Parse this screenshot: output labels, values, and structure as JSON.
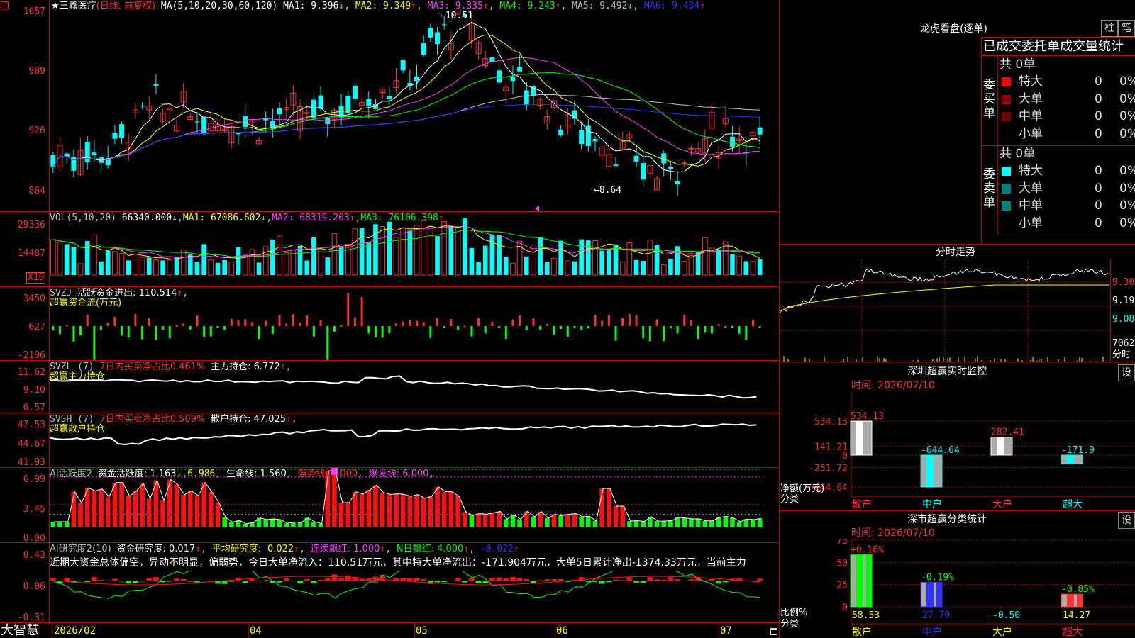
{
  "header": {
    "stock_name": "★三鑫医疗",
    "mode": "(日线, 前复权)",
    "ma_title": "MA(5,10,20,30,60,120)",
    "ma": [
      {
        "label": "MA1: 9.396",
        "arrow": "↓",
        "color": "#ffffff"
      },
      {
        "label": "MA2: 9.349",
        "arrow": "↑",
        "color": "#ffff00"
      },
      {
        "label": "MA3: 9.335",
        "arrow": "↑",
        "color": "#ff40ff"
      },
      {
        "label": "MA4: 9.243",
        "arrow": "↑",
        "color": "#00ff00"
      },
      {
        "label": "MA5: 9.492",
        "arrow": "↓",
        "color": "#c0c0c0"
      },
      {
        "label": "MA6: 9.434",
        "arrow": "↑",
        "color": "#3030ff"
      }
    ],
    "high_mark": "10.51",
    "low_mark": "8.64",
    "corner_icon": "settings-square-icon"
  },
  "price_axis": [
    "1057",
    "989",
    "926",
    "864"
  ],
  "vol": {
    "title": "VOL(5,10,20)",
    "value": "66340.000",
    "value_arrow": "↓",
    "ma1": "MA1: 67086.602",
    "ma1_arrow": "↓",
    "ma2": "MA2: 68319.203",
    "ma2_arrow": "↑",
    "ma3": "MA3: 76106.398",
    "ma3_arrow": "↑",
    "axis": [
      "29336",
      "14487"
    ],
    "unit": "X10"
  },
  "svzj": {
    "title": "SVZJ",
    "line": "活跃资金进出: 110.514",
    "arrow": "↑",
    "trail": ",",
    "subtitle": "超赢资金流(万元)",
    "axis": [
      "3450",
      "627",
      "-2196"
    ]
  },
  "svzl": {
    "title": "SVZL (7)",
    "ratio": "7日内买卖净占比0.461%",
    "hold": "主力持仓: 6.772",
    "arrow": "↑",
    "trail": ",",
    "subtitle": "超赢主力持仓",
    "axis": [
      "11.62",
      "9.10",
      "6.57"
    ]
  },
  "svsh": {
    "title": "SVSH (7)",
    "ratio": "7日内买卖净占比0.509%",
    "hold": "散户持仓: 47.025",
    "arrow": "↑",
    "trail": ",",
    "subtitle": "超赢散户持仓",
    "axis": [
      "47.53",
      "44.67",
      "41.93"
    ]
  },
  "ai_active": {
    "title": "AI活跃度2",
    "active": "资金活跃度: 1.163",
    "active_arrow": "↓",
    "v2": "6.986",
    "life": "生命线: 1.560",
    "strong": "强势线: 3.000",
    "burst": "爆发线: 6.000",
    "trail": ",",
    "axis": [
      "6.99",
      "3.45",
      "0.00"
    ]
  },
  "ai_research": {
    "title": "AI研究度2(10)",
    "research": "资金研究度: 0.017",
    "research_arrow": "↑",
    "avg": "平均研究度: -0.022",
    "avg_arrow": "↑",
    "cont": "连续飘红: 1.000",
    "cont_arrow": "↑",
    "nday": "N日飘红: 4.000",
    "nday_arrow": "↑",
    "last": "-0.022",
    "last_arrow": "↑",
    "summary": "近期大资金总体偏空，异动不明显，偏弱势，今日大单净流入：110.51万元，其中特大单净流出：-171.904万元，大单5日累计净出-1374.33万元，当前主力",
    "axis": [
      "0.43",
      "0.06",
      "-0.31"
    ]
  },
  "bottom": {
    "brand": "大智慧",
    "dates": [
      "2026/02",
      "04",
      "05",
      "06",
      "07"
    ]
  },
  "side": {
    "dragon_title": "龙虎看盘(逐单)",
    "btn_zhu": "柱",
    "btn_bi": "笔",
    "stat_title": "已成交委托单成交量统计",
    "buy_label": "委买单",
    "sell_label": "委卖单",
    "buy_total": "共 0单",
    "sell_total": "共 0单",
    "buy_rows": [
      {
        "name": "特大",
        "count": "0",
        "pct": "0%",
        "color": "#ff0000"
      },
      {
        "name": "大单",
        "count": "0",
        "pct": "0%",
        "color": "#900000"
      },
      {
        "name": "中单",
        "count": "0",
        "pct": "0%",
        "color": "#700000"
      },
      {
        "name": "小单",
        "count": "0",
        "pct": "0%",
        "color": ""
      }
    ],
    "sell_rows": [
      {
        "name": "特大",
        "count": "0",
        "pct": "0%",
        "color": "#00ffff"
      },
      {
        "name": "大单",
        "count": "0",
        "pct": "0%",
        "color": "#008080"
      },
      {
        "name": "中单",
        "count": "0",
        "pct": "0%",
        "color": "#008080"
      },
      {
        "name": "小单",
        "count": "0",
        "pct": "0%",
        "color": ""
      }
    ],
    "intraday_title": "分时走势",
    "intraday_axis": [
      "9.30",
      "9.19",
      "9.08",
      "7062"
    ],
    "intraday_unit": "分时",
    "monitor_title": "深圳超赢实时监控",
    "monitor_btn": "设",
    "monitor_time": "时间: 2026/07/10",
    "monitor_axis": [
      "534.13",
      "141.21",
      "0",
      "-251.72",
      "-644.64"
    ],
    "monitor_unit": "净额(万元)",
    "monitor_unit2": "分类",
    "monitor_bars": [
      {
        "name": "散户",
        "value": 534.13,
        "label": "534.13"
      },
      {
        "name": "中户",
        "value": -644.64,
        "label": "-644.64"
      },
      {
        "name": "大户",
        "value": 282.41,
        "label": "282.41"
      },
      {
        "name": "超大",
        "value": -171.9,
        "label": "-171.9"
      }
    ],
    "class_title": "深市超赢分类统计",
    "class_btn": "设",
    "class_time": "时间: 2026/07/10",
    "class_axis": [
      "75",
      "50",
      "25",
      "0"
    ],
    "class_unit": "比例%",
    "class_unit2": "分类",
    "class_bars": [
      {
        "name": "散户",
        "value": 58.53,
        "change": "+0.16%",
        "label": "58.53",
        "color": "#00ff00"
      },
      {
        "name": "中户",
        "value": 27.7,
        "change": "-0.19%",
        "label": "27.70",
        "color": "#3030ff"
      },
      {
        "name": "大户",
        "value": -0.5,
        "change": "",
        "label": "-0.50",
        "color": "#00ffff"
      },
      {
        "name": "超大",
        "value": 14.27,
        "change": "-0.05%",
        "label": "14.27",
        "color": "#ff3030"
      }
    ]
  }
}
